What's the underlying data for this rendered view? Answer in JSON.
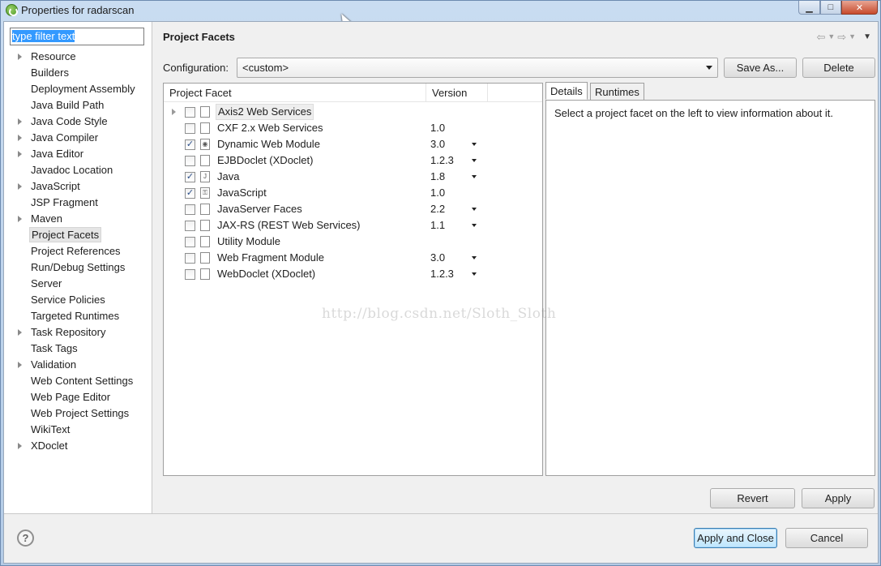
{
  "window": {
    "title": "Properties for radarscan",
    "minimize_label": "▁",
    "maximize_label": "□",
    "close_label": "✕"
  },
  "filter": {
    "value": "type filter text"
  },
  "tree": {
    "items": [
      {
        "label": "Resource",
        "expandable": true
      },
      {
        "label": "Builders",
        "expandable": false
      },
      {
        "label": "Deployment Assembly",
        "expandable": false
      },
      {
        "label": "Java Build Path",
        "expandable": false
      },
      {
        "label": "Java Code Style",
        "expandable": true
      },
      {
        "label": "Java Compiler",
        "expandable": true
      },
      {
        "label": "Java Editor",
        "expandable": true
      },
      {
        "label": "Javadoc Location",
        "expandable": false
      },
      {
        "label": "JavaScript",
        "expandable": true
      },
      {
        "label": "JSP Fragment",
        "expandable": false
      },
      {
        "label": "Maven",
        "expandable": true
      },
      {
        "label": "Project Facets",
        "expandable": false,
        "selected": true
      },
      {
        "label": "Project References",
        "expandable": false
      },
      {
        "label": "Run/Debug Settings",
        "expandable": false
      },
      {
        "label": "Server",
        "expandable": false
      },
      {
        "label": "Service Policies",
        "expandable": false
      },
      {
        "label": "Targeted Runtimes",
        "expandable": false
      },
      {
        "label": "Task Repository",
        "expandable": true
      },
      {
        "label": "Task Tags",
        "expandable": false
      },
      {
        "label": "Validation",
        "expandable": true
      },
      {
        "label": "Web Content Settings",
        "expandable": false
      },
      {
        "label": "Web Page Editor",
        "expandable": false
      },
      {
        "label": "Web Project Settings",
        "expandable": false
      },
      {
        "label": "WikiText",
        "expandable": false
      },
      {
        "label": "XDoclet",
        "expandable": true
      }
    ]
  },
  "header": {
    "title": "Project Facets"
  },
  "configuration": {
    "label": "Configuration:",
    "value": "<custom>",
    "save_as_label": "Save As...",
    "delete_label": "Delete"
  },
  "facets": {
    "col_facet": "Project Facet",
    "col_version": "Version",
    "rows": [
      {
        "name": "Axis2 Web Services",
        "version": "",
        "checked": false,
        "has_children": true,
        "has_dropdown": false
      },
      {
        "name": "CXF 2.x Web Services",
        "version": "1.0",
        "checked": false,
        "has_children": false,
        "has_dropdown": false
      },
      {
        "name": "Dynamic Web Module",
        "version": "3.0",
        "checked": true,
        "has_children": false,
        "has_dropdown": true
      },
      {
        "name": "EJBDoclet (XDoclet)",
        "version": "1.2.3",
        "checked": false,
        "has_children": false,
        "has_dropdown": true
      },
      {
        "name": "Java",
        "version": "1.8",
        "checked": true,
        "has_children": false,
        "has_dropdown": true
      },
      {
        "name": "JavaScript",
        "version": "1.0",
        "checked": true,
        "has_children": false,
        "has_dropdown": false
      },
      {
        "name": "JavaServer Faces",
        "version": "2.2",
        "checked": false,
        "has_children": false,
        "has_dropdown": true
      },
      {
        "name": "JAX-RS (REST Web Services)",
        "version": "1.1",
        "checked": false,
        "has_children": false,
        "has_dropdown": true
      },
      {
        "name": "Utility Module",
        "version": "",
        "checked": false,
        "has_children": false,
        "has_dropdown": false
      },
      {
        "name": "Web Fragment Module",
        "version": "3.0",
        "checked": false,
        "has_children": false,
        "has_dropdown": true
      },
      {
        "name": "WebDoclet (XDoclet)",
        "version": "1.2.3",
        "checked": false,
        "has_children": false,
        "has_dropdown": true
      }
    ]
  },
  "watermark": "http://blog.csdn.net/Sloth_Sloth",
  "details": {
    "tab_details": "Details",
    "tab_runtimes": "Runtimes",
    "text": "Select a project facet on the left to view information about it."
  },
  "actions": {
    "revert_label": "Revert",
    "apply_label": "Apply",
    "apply_close_label": "Apply and Close",
    "cancel_label": "Cancel",
    "help_label": "?"
  }
}
